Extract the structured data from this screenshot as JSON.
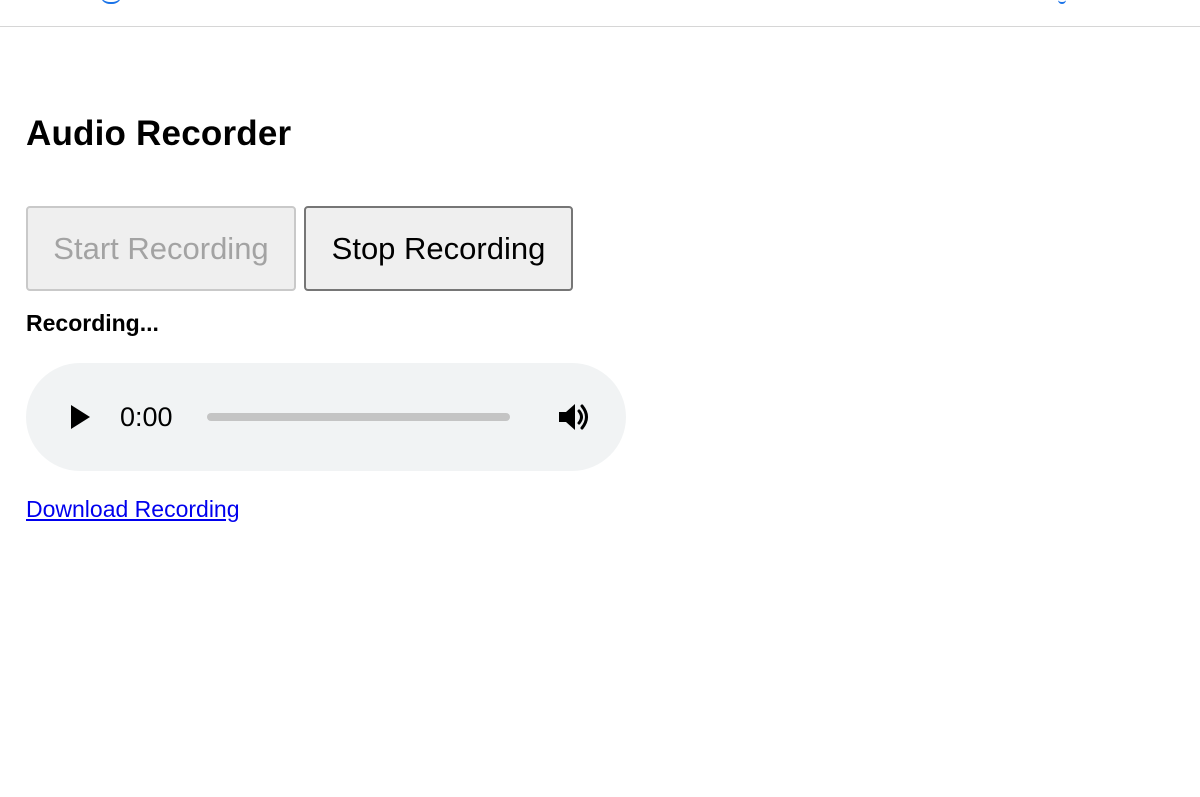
{
  "page": {
    "title": "Audio Recorder"
  },
  "controls": {
    "start_label": "Start Recording",
    "stop_label": "Stop Recording",
    "start_disabled": true
  },
  "status": {
    "text": "Recording..."
  },
  "player": {
    "time": "0:00",
    "progress": 0,
    "play_icon": "play-icon",
    "volume_icon": "volume-icon"
  },
  "download": {
    "label": "Download Recording"
  },
  "colors": {
    "link": "#0000ee",
    "player_background": "#f1f3f4",
    "disabled_text": "#a3a3a3",
    "button_background": "#efefef"
  }
}
